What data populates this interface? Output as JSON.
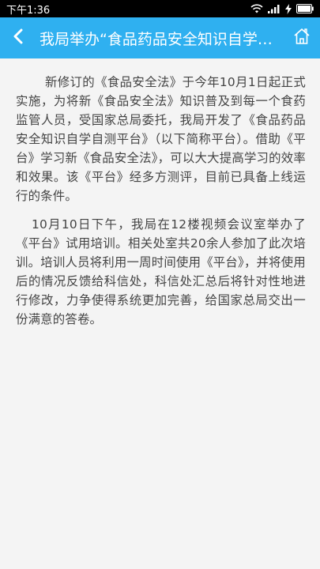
{
  "status_bar": {
    "time": "下午1:36",
    "icons": [
      "wifi-icon",
      "signal-icon",
      "charging-icon",
      "battery-icon"
    ]
  },
  "app_bar": {
    "title": "我局举办“食品药品安全知识自学自测平台”试用培训",
    "back_icon": "chevron-left-icon",
    "home_icon": "home-icon",
    "color": "#2fb0f0"
  },
  "article": {
    "paragraphs": [
      "新修订的《食品安全法》于今年10月1日起正式实施，为将新《食品安全法》知识普及到每一个食药监管人员，受国家总局委托，我局开发了《食品药品安全知识自学自测平台》（以下简称平台）。借助《平台》学习新《食品安全法》，可以大大提高学习的效率和效果。该《平台》经多方测评，目前已具备上线运行的条件。",
      "10月10日下午，我局在12楼视频会议室举办了《平台》试用培训。相关处室共20余人参加了此次培训。培训人员将利用一周时间使用《平台》，并将使用后的情况反馈给科信处，科信处汇总后将针对性地进行修改，力争使得系统更加完善，给国家总局交出一份满意的答卷。"
    ]
  }
}
